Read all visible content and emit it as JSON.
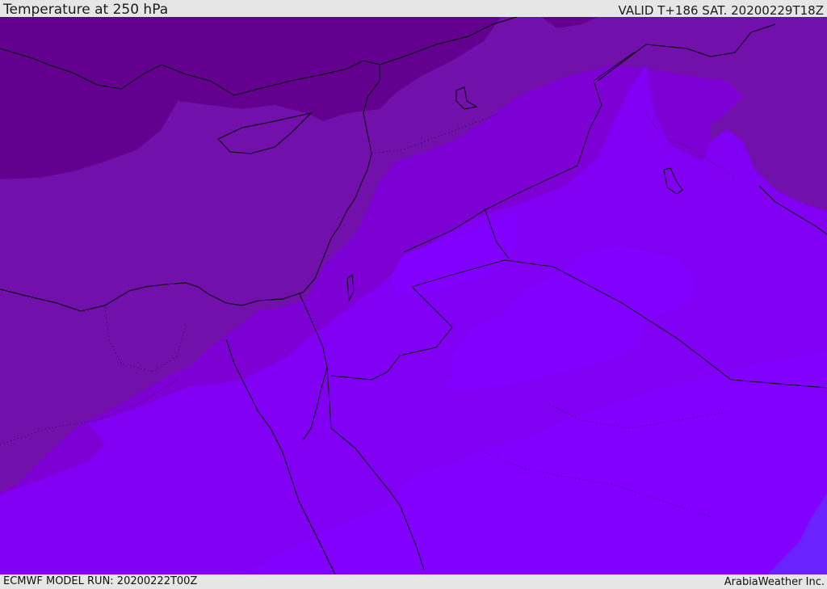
{
  "header": {
    "title": "Temperature at 250 hPa",
    "valid_time": "VALID T+186 SAT. 20200229T18Z"
  },
  "footer": {
    "model_run": "ECMWF MODEL RUN: 20200222T00Z",
    "credit": "ArabiaWeather Inc."
  },
  "map": {
    "field": "temperature",
    "level": "250 hPa",
    "region": "Eastern Mediterranean / Middle East",
    "colors": {
      "darkest": "#63008f",
      "dark": "#7110ab",
      "mid": "#7d00d5",
      "light": "#8100f4",
      "lightest": "#8200ff",
      "blue_edge": "#6a22ff",
      "coastline": "#000000"
    }
  }
}
